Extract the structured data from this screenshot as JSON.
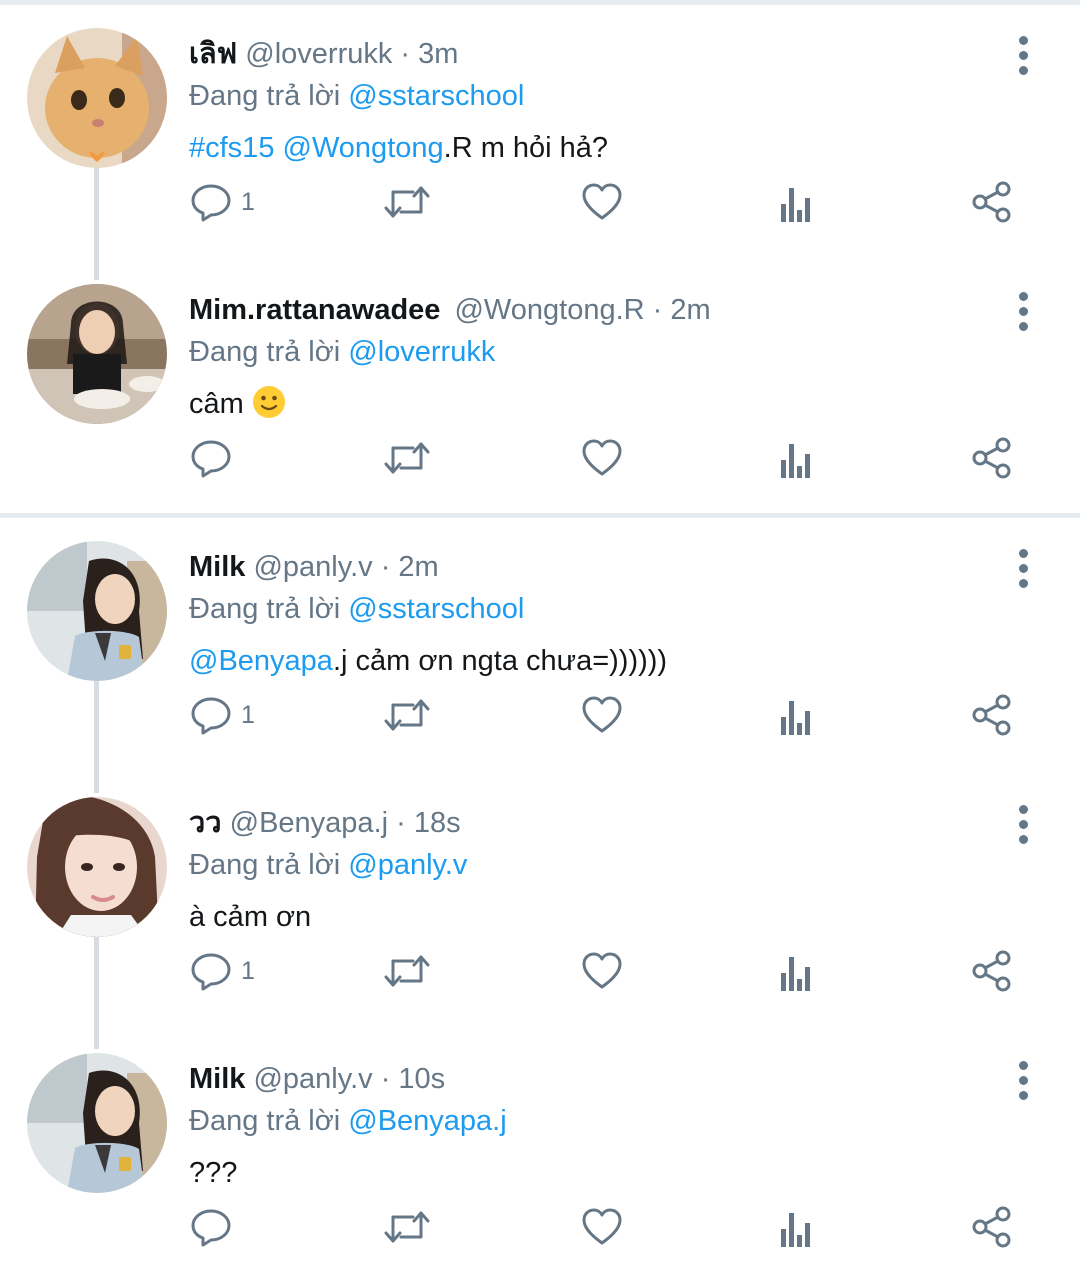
{
  "tweets": [
    {
      "name": "เลิฟ",
      "handle": "@loverrukk",
      "dot": " · ",
      "time": "3m",
      "reply_prefix": "Đang trả lời ",
      "reply_to": "@sstarschool",
      "body_hashtag": "#cfs15",
      "body_mention": "@Wongtong",
      "body_text": ".R  m hỏi hả?",
      "reply_count": "1",
      "avatar_icon": "cat-avatar"
    },
    {
      "name": "Mim.rattanawadee",
      "handle": "@Wongtong.R",
      "dot": " · ",
      "time": "2m",
      "reply_prefix": "Đang trả lời ",
      "reply_to": "@loverrukk",
      "body_text": "câm",
      "body_emoji": "slightly-smiling-face-emoji",
      "reply_count": "",
      "avatar_icon": "girl-dining-avatar"
    },
    {
      "name": "Milk",
      "handle": "@panly.v",
      "dot": " · ",
      "time": "2m",
      "reply_prefix": "Đang trả lời ",
      "reply_to": "@sstarschool",
      "body_mention": "@Benyapa",
      "body_text": ".j cảm ơn ngta chưa=))))))",
      "reply_count": "1",
      "avatar_icon": "student-uniform-avatar"
    },
    {
      "name": "วว",
      "handle": "@Benyapa.j",
      "dot": " · ",
      "time": "18s",
      "reply_prefix": "Đang trả lời ",
      "reply_to": "@panly.v",
      "body_text": "à cảm ơn",
      "reply_count": "1",
      "avatar_icon": "girl-portrait-avatar"
    },
    {
      "name": "Milk",
      "handle": "@panly.v",
      "dot": " · ",
      "time": "10s",
      "reply_prefix": "Đang trả lời ",
      "reply_to": "@Benyapa.j",
      "body_text": "???",
      "reply_count": "",
      "avatar_icon": "student-uniform-avatar"
    }
  ],
  "colors": {
    "accent": "#1d9bf0",
    "secondary_text": "#657786",
    "divider": "#e6ecf0",
    "thread_line": "#d6dce1"
  },
  "icons": [
    "reply-icon",
    "retweet-icon",
    "like-icon",
    "analytics-icon",
    "share-icon",
    "more-options-icon"
  ]
}
